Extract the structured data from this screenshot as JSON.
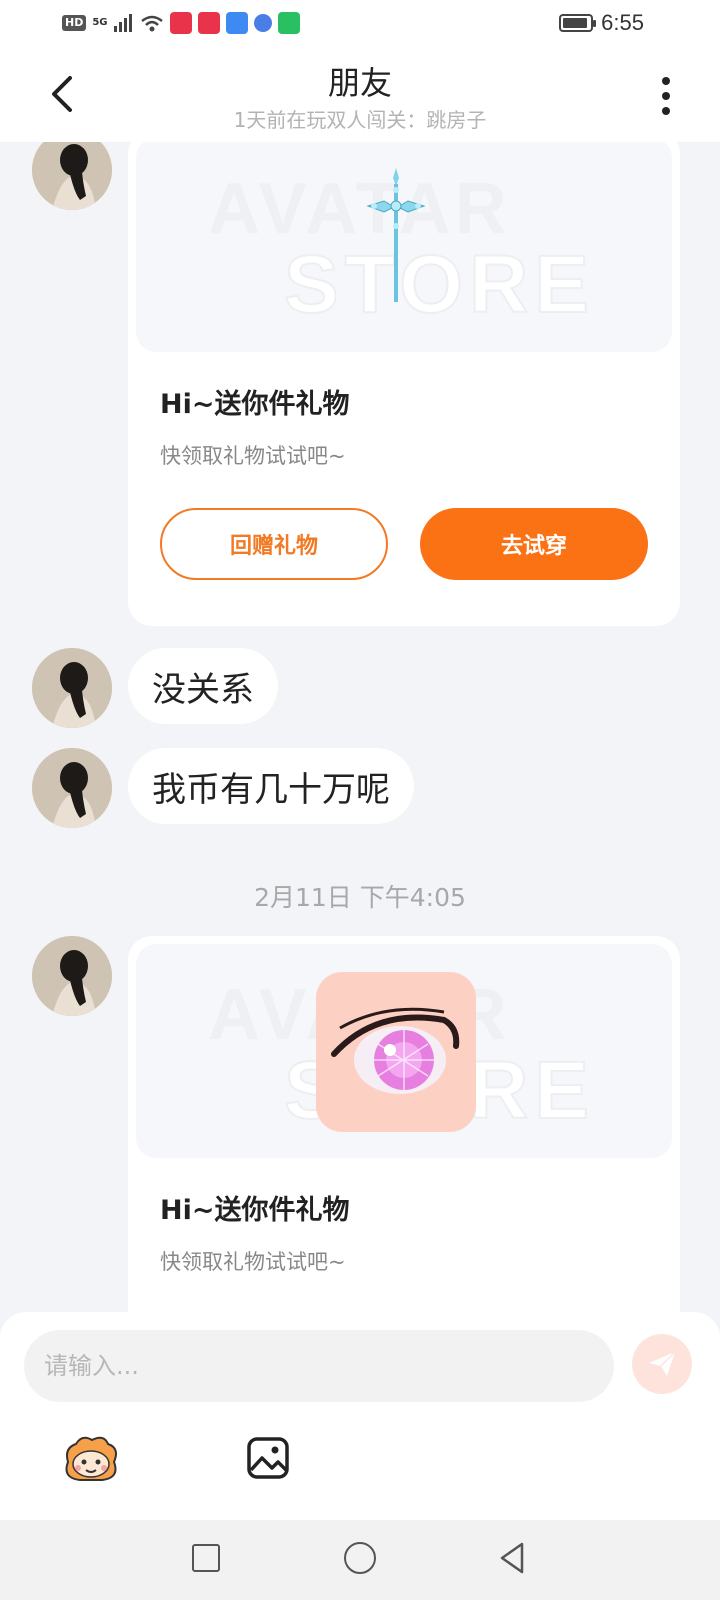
{
  "status_bar": {
    "hd_badge": "HD",
    "network": "5G",
    "time": "6:55"
  },
  "header": {
    "title": "朋友",
    "subtitle": "1天前在玩双人闯关：跳房子"
  },
  "messages": {
    "gift_card_1": {
      "watermark_top": "AVATAR",
      "watermark_bottom": "STORE",
      "title": "Hi~送你件礼物",
      "description": "快领取礼物试试吧~",
      "return_gift_label": "回赠礼物",
      "try_on_label": "去试穿"
    },
    "text_1": "没关系",
    "text_2": "我币有几十万呢",
    "timestamp": "2月11日 下午4:05",
    "gift_card_2": {
      "watermark_top": "AVATAR",
      "watermark_bottom": "STORE",
      "title": "Hi~送你件礼物",
      "description": "快领取礼物试试吧~"
    }
  },
  "input": {
    "placeholder": "请输入..."
  },
  "colors": {
    "accent": "#fb7214",
    "send_disabled": "#fde3dc",
    "background": "#f2f4f7"
  },
  "icons": [
    "back-arrow-icon",
    "more-vertical-icon",
    "send-icon",
    "emoji-mascot-icon",
    "image-icon",
    "battery-icon"
  ]
}
